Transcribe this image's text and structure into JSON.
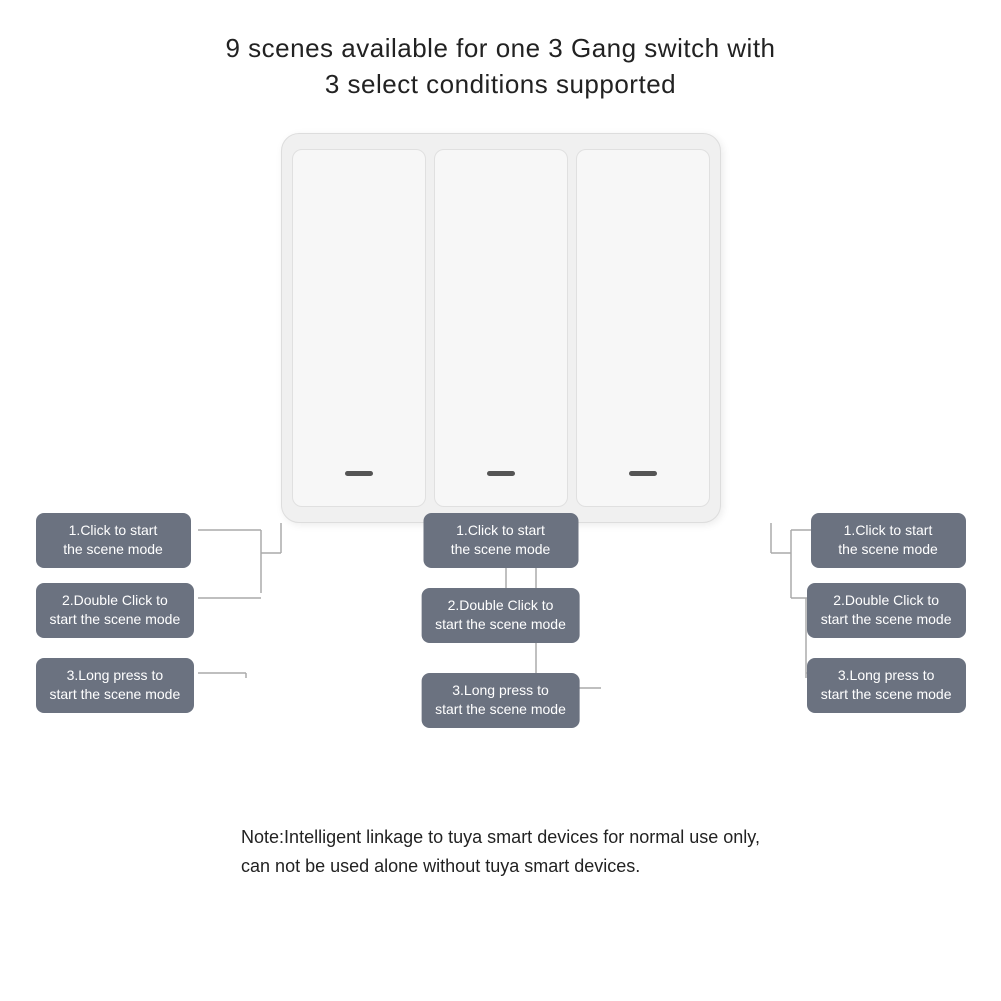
{
  "title": {
    "line1": "9 scenes available for one 3 Gang switch with",
    "line2": "3 select conditions supported"
  },
  "switch": {
    "buttons": [
      "left",
      "center",
      "right"
    ]
  },
  "labels": {
    "left": [
      "1.Click to start\nthe scene mode",
      "2.Double Click to\nstart the scene mode",
      "3.Long press to\nstart the scene mode"
    ],
    "center": [
      "1.Click to start\nthe scene mode",
      "2.Double Click to\nstart the scene mode",
      "3.Long press to\nstart the scene mode"
    ],
    "right": [
      "1.Click to start\nthe scene mode",
      "2.Double Click to\nstart the scene mode",
      "3.Long press to\nstart the scene mode"
    ]
  },
  "note": "Note:Intelligent linkage to tuya smart devices for normal use only,\ncan not be used alone without tuya smart devices."
}
